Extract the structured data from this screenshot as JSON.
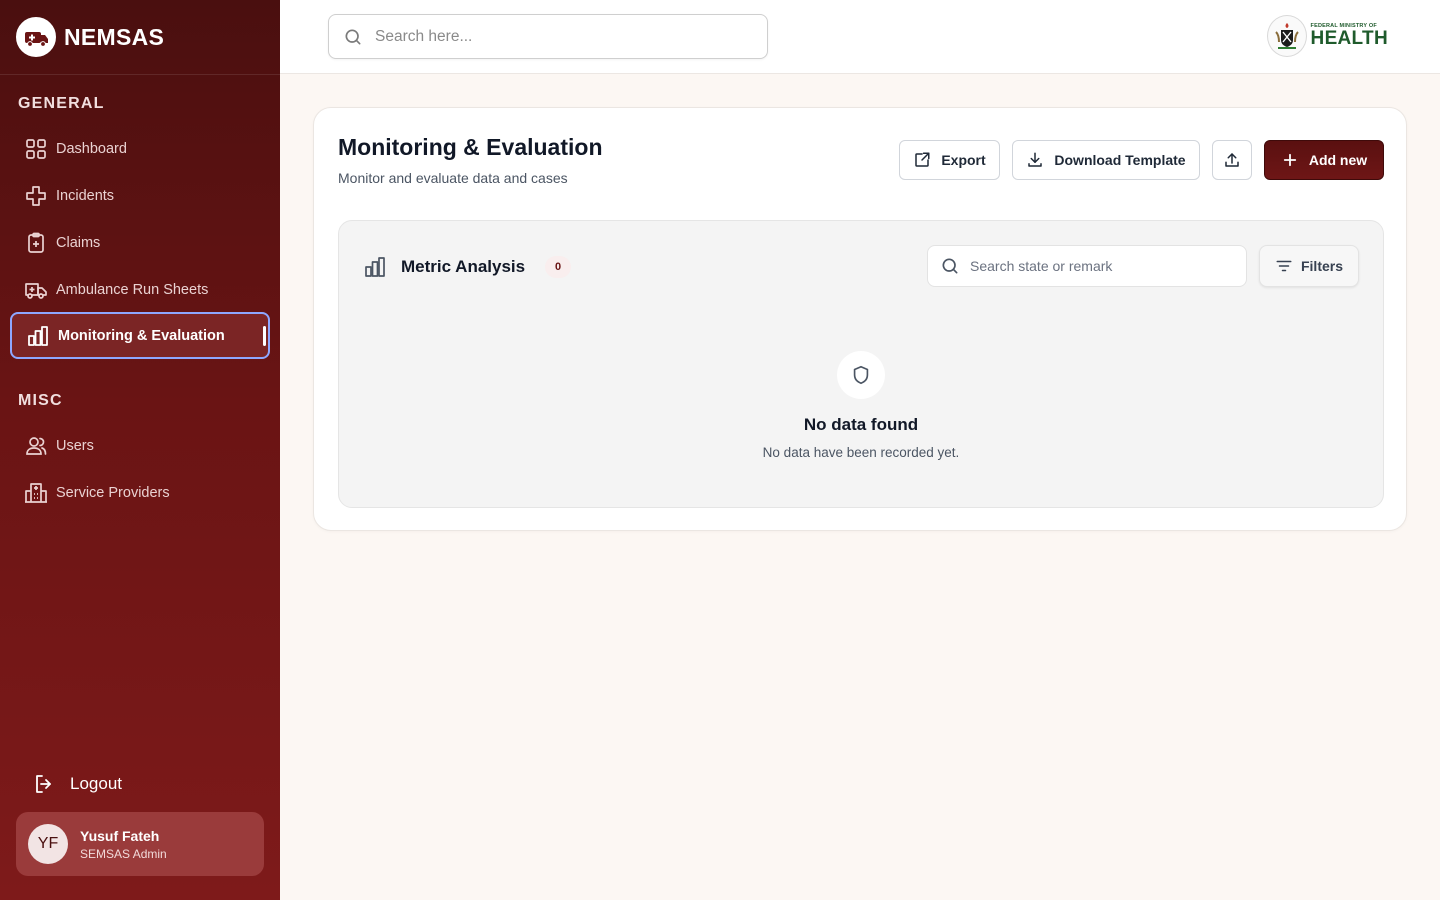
{
  "app": {
    "name": "NEMSAS"
  },
  "sidebar": {
    "sections": [
      {
        "title": "GENERAL"
      },
      {
        "title": "MISC"
      }
    ],
    "general_items": [
      {
        "label": "Dashboard",
        "icon": "grid-icon"
      },
      {
        "label": "Incidents",
        "icon": "medical-cross-icon"
      },
      {
        "label": "Claims",
        "icon": "clipboard-plus-icon"
      },
      {
        "label": "Ambulance Run Sheets",
        "icon": "ambulance-icon"
      },
      {
        "label": "Monitoring & Evaluation",
        "icon": "bar-chart-icon",
        "active": true
      }
    ],
    "misc_items": [
      {
        "label": "Users",
        "icon": "users-icon"
      },
      {
        "label": "Service Providers",
        "icon": "building-icon"
      }
    ],
    "logout_label": "Logout",
    "user": {
      "initials": "YF",
      "name": "Yusuf Fateh",
      "role": "SEMSAS Admin"
    }
  },
  "header": {
    "search_placeholder": "Search here...",
    "ministry_small": "FEDERAL MINISTRY OF",
    "ministry_big": "HEALTH"
  },
  "main": {
    "title": "Monitoring & Evaluation",
    "subtitle": "Monitor and evaluate data and cases",
    "export_label": "Export",
    "template_label": "Download Template",
    "add_label": "Add new",
    "panel": {
      "title": "Metric Analysis",
      "count": "0",
      "search_placeholder": "Search state or remark",
      "filters_label": "Filters",
      "empty_title": "No data found",
      "empty_subtitle": "No data have been recorded yet."
    }
  },
  "colors": {
    "brand": "#6a1414",
    "active_border": "#8ea7ff",
    "ministry_green": "#1f5b2c"
  }
}
